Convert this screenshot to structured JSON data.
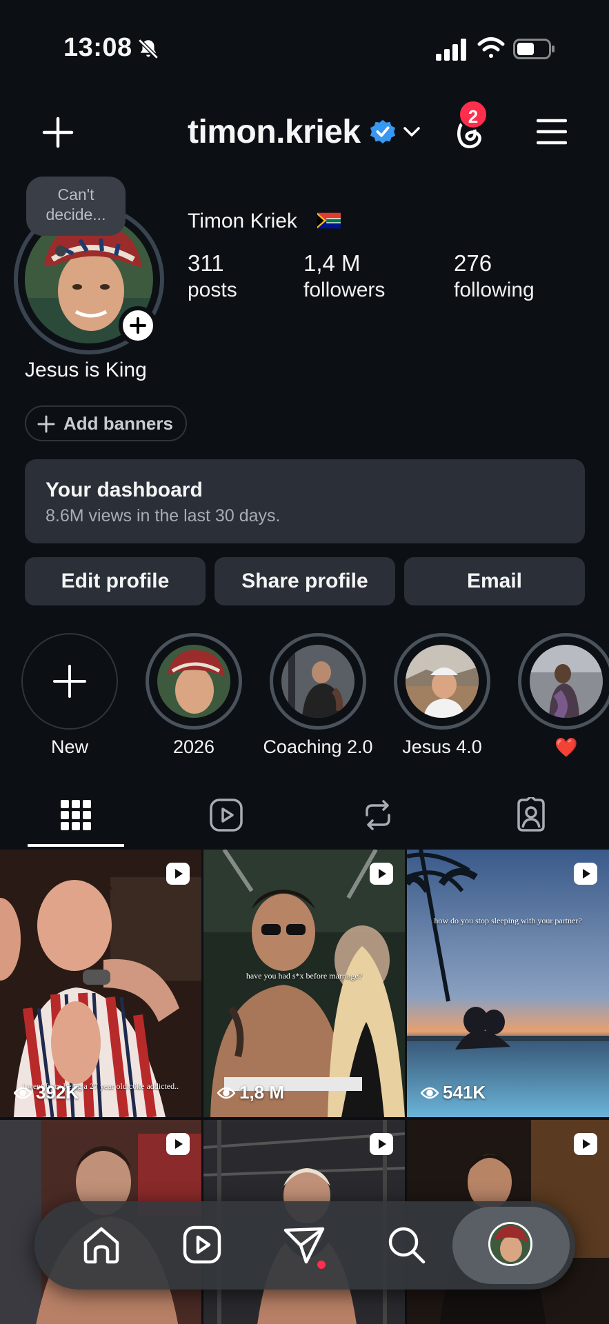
{
  "status_bar": {
    "time": "13:08"
  },
  "header": {
    "username": "timon.kriek",
    "notification_count": "2"
  },
  "profile": {
    "note": "Can't decide...",
    "full_name": "Timon Kriek",
    "stats": [
      {
        "value": "311",
        "label": "posts"
      },
      {
        "value": "1,4 M",
        "label": "followers"
      },
      {
        "value": "276",
        "label": "following"
      }
    ],
    "bio": "Jesus is King",
    "add_banners": "Add banners"
  },
  "dashboard": {
    "title": "Your dashboard",
    "subtitle": "8.6M views in the last 30 days."
  },
  "buttons": {
    "edit": "Edit profile",
    "share": "Share profile",
    "email": "Email"
  },
  "highlights": [
    {
      "label": "New"
    },
    {
      "label": "2026"
    },
    {
      "label": "Coaching 2.0"
    },
    {
      "label": "Jesus 4.0"
    },
    {
      "label": "❤️"
    }
  ],
  "tabs": [
    "grid",
    "reels",
    "reposts",
    "tagged"
  ],
  "posts": [
    {
      "views": "392K",
      "caption": "i went from being a 27 year old c0ke addicted.."
    },
    {
      "views": "1,8 M",
      "caption": "have you had s*x before marriage?"
    },
    {
      "views": "541K",
      "caption": "how do you stop sleeping with your partner?"
    },
    {
      "views": "",
      "caption": ""
    },
    {
      "views": "",
      "caption": ""
    },
    {
      "views": "",
      "caption": ""
    }
  ],
  "colors": {
    "background": "#0c1014",
    "card": "#2b3038",
    "verified": "#3897f0",
    "badge": "#ff2e4c"
  }
}
